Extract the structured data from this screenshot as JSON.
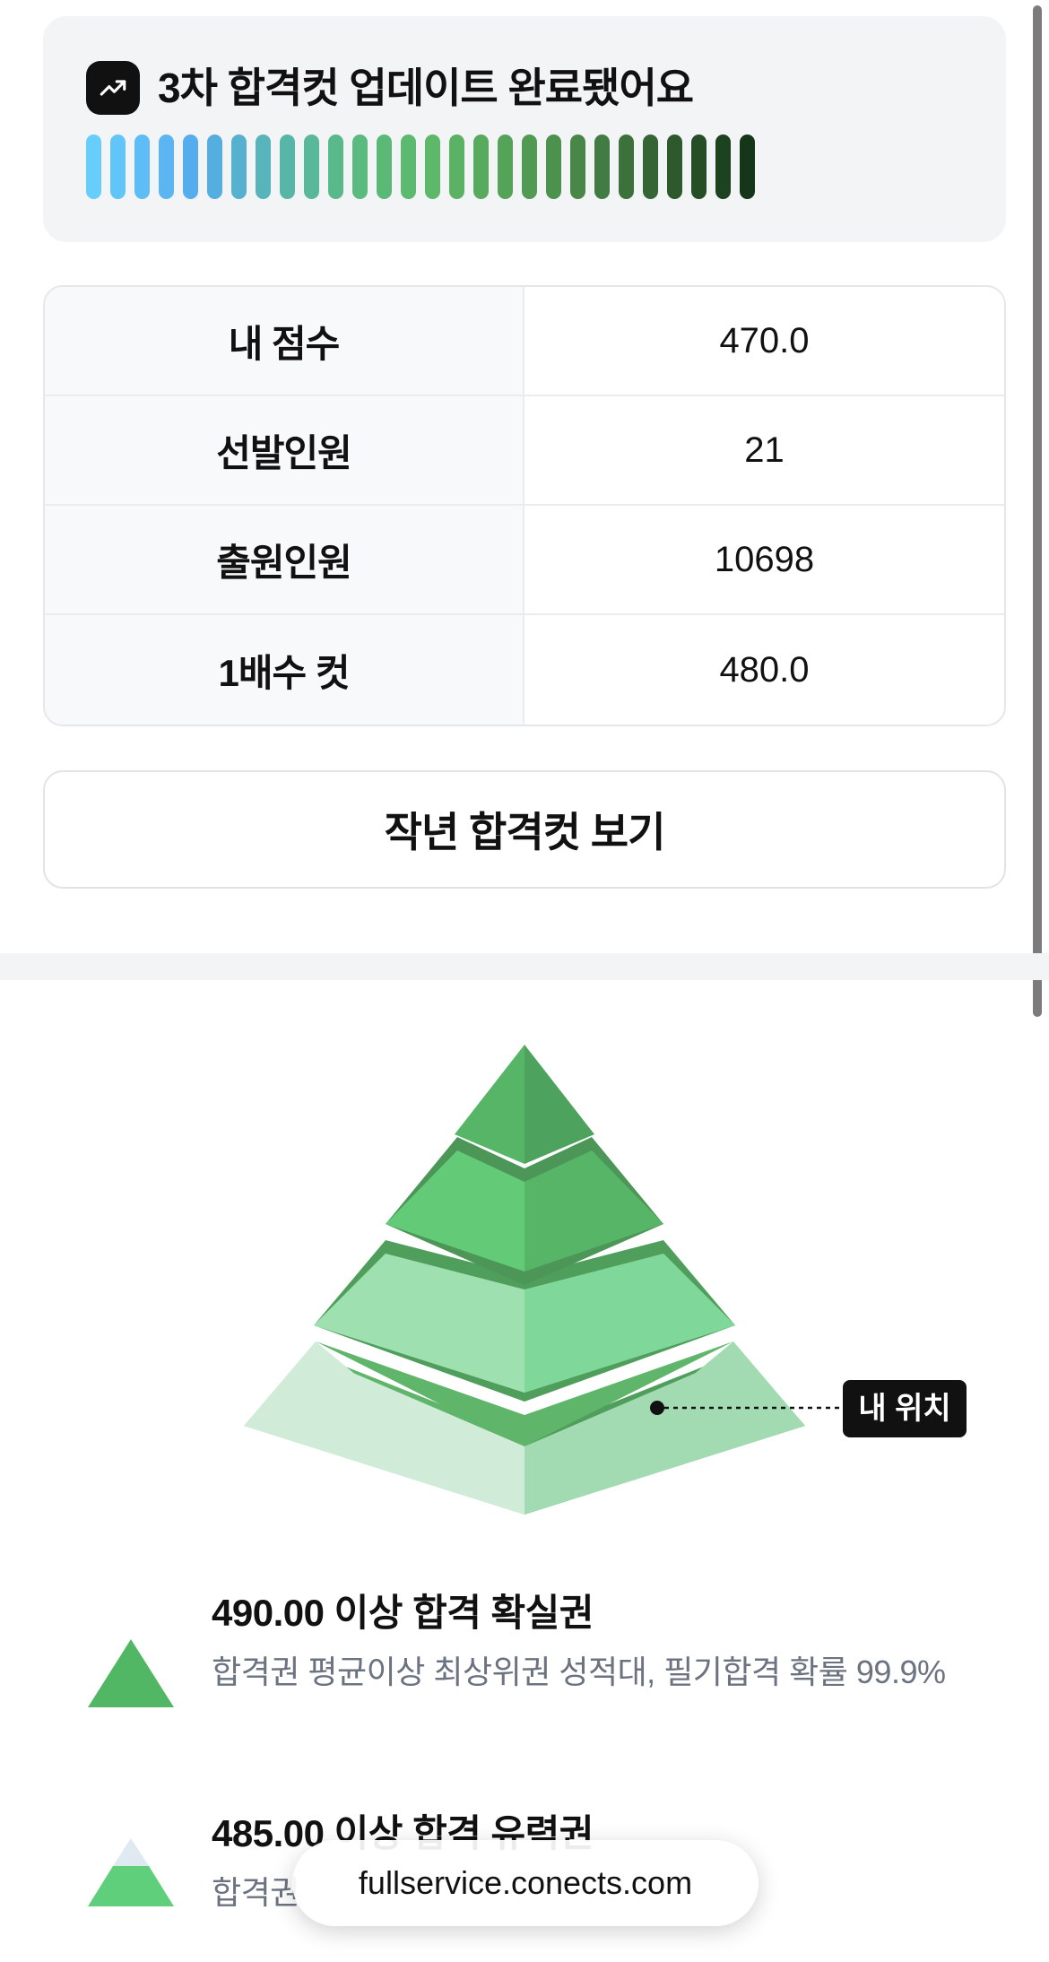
{
  "update": {
    "title": "3차 합격컷 업데이트 완료됐어요",
    "icon": "trending-up-icon",
    "bar_colors": [
      "#67cdfa",
      "#62c5f7",
      "#5ebdf4",
      "#5ab5f1",
      "#56adee",
      "#55aee0",
      "#55b1cd",
      "#56b4ba",
      "#57b6a8",
      "#58b898",
      "#59b98b",
      "#5aba80",
      "#5bb977",
      "#5cb970",
      "#5db86a",
      "#5bb264",
      "#58ab5e",
      "#55a359",
      "#519a54",
      "#4d914e",
      "#488748",
      "#437c42",
      "#3d713b",
      "#366535",
      "#2d592d",
      "#254d26",
      "#1d4220",
      "#16361a"
    ]
  },
  "stats": {
    "rows": [
      {
        "label": "내 점수",
        "value": "470.0"
      },
      {
        "label": "선발인원",
        "value": "21"
      },
      {
        "label": "출원인원",
        "value": "10698"
      },
      {
        "label": "1배수 컷",
        "value": "480.0"
      }
    ]
  },
  "last_year_button": "작년 합격컷 보기",
  "pyramid": {
    "marker_label": "내 위치"
  },
  "legend": [
    {
      "title": "490.00 이상 합격 확실권",
      "desc": "합격권 평균이상 최상위권 성적대, 필기합격 확률 99.9%"
    },
    {
      "title": "485.00 이상 합격 유력권",
      "desc": "합격권"
    }
  ],
  "browser": {
    "url": "fullservice.conects.com"
  }
}
